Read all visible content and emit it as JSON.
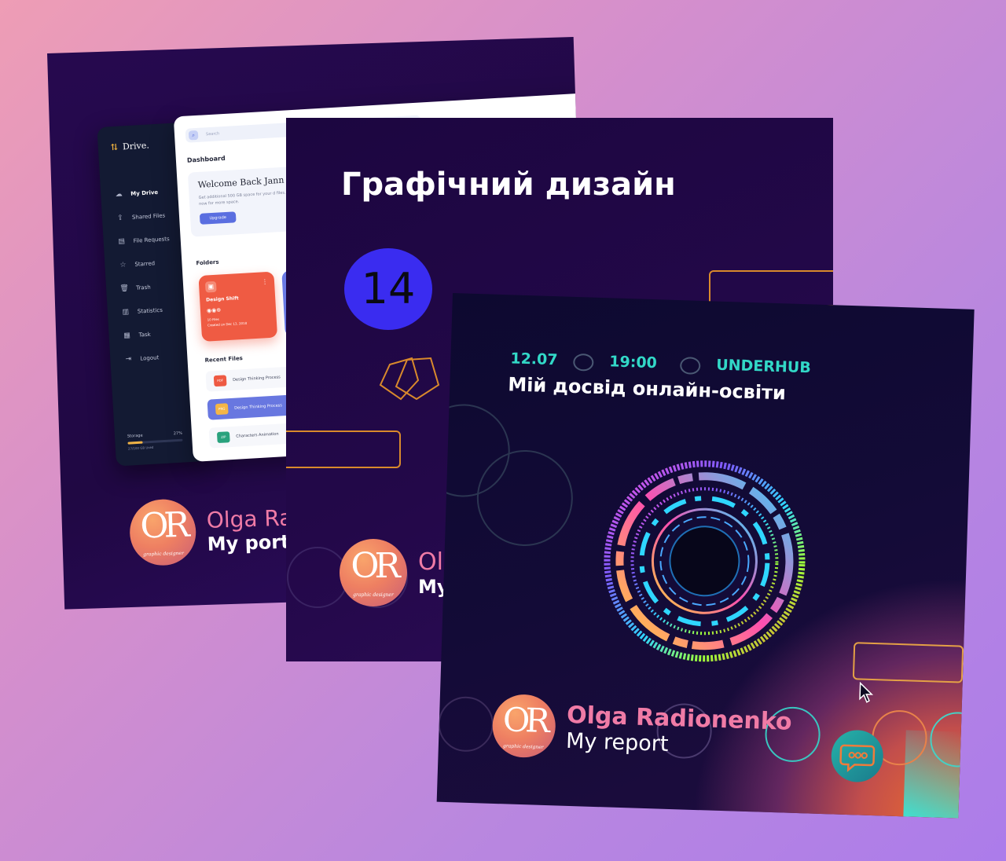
{
  "portfolio": {
    "drive": {
      "brand": "Drive.",
      "nav": [
        {
          "icon": "☁",
          "label": "My Drive"
        },
        {
          "icon": "⇪",
          "label": "Shared Files"
        },
        {
          "icon": "▤",
          "label": "File Requests"
        },
        {
          "icon": "☆",
          "label": "Starred"
        },
        {
          "icon": "🗑",
          "label": "Trash"
        },
        {
          "icon": "▥",
          "label": "Statistics"
        },
        {
          "icon": "▦",
          "label": "Task"
        },
        {
          "icon": "⇥",
          "label": "Logout"
        }
      ],
      "storage_label": "Storage",
      "storage_percent": "27%",
      "storage_fraction": 0.27,
      "storage_used": "27/100 GB Used",
      "search_placeholder": "Search",
      "dashboard_heading": "Dashboard",
      "welcome_title": "Welcome Back Jann",
      "welcome_text": "Get additional 500 GB space for your d files. Unlock now for more space.",
      "upgrade_label": "Upgrade",
      "folders_heading": "Folders",
      "folder": {
        "name": "Design Shift",
        "files": "10 Files",
        "created": "Created on Dec 13, 2018"
      },
      "recent_heading": "Recent Files",
      "recent_files": [
        {
          "type": "PDF",
          "name": "Design Thinking Process",
          "color": "#ee5a43"
        },
        {
          "type": "PNG",
          "name": "Design Thinking Process",
          "color": "#f4b546"
        },
        {
          "type": "ZIP",
          "name": "Characters Animation",
          "color": "#2aa27d"
        }
      ]
    },
    "sig_name": "Olga Rad",
    "sig_sub": "My portfo"
  },
  "graphic": {
    "title": "Графічний дизайн",
    "number": "14",
    "sig_name": "Ol",
    "sig_sub": "My"
  },
  "report": {
    "date": "12.07",
    "time": "19:00",
    "venue": "UNDERHUB",
    "title": "Мій досвід онлайн-освіти",
    "sig_name": "Olga Radionenko",
    "sig_sub": "My report"
  },
  "logo": {
    "monogram": "OR",
    "tagline": "graphic designer"
  },
  "colors": {
    "accent_teal": "#32d8c7",
    "accent_orange": "#d98a2c",
    "badge_blue": "#3a2cf0",
    "name_pink": "#f07ba6"
  }
}
